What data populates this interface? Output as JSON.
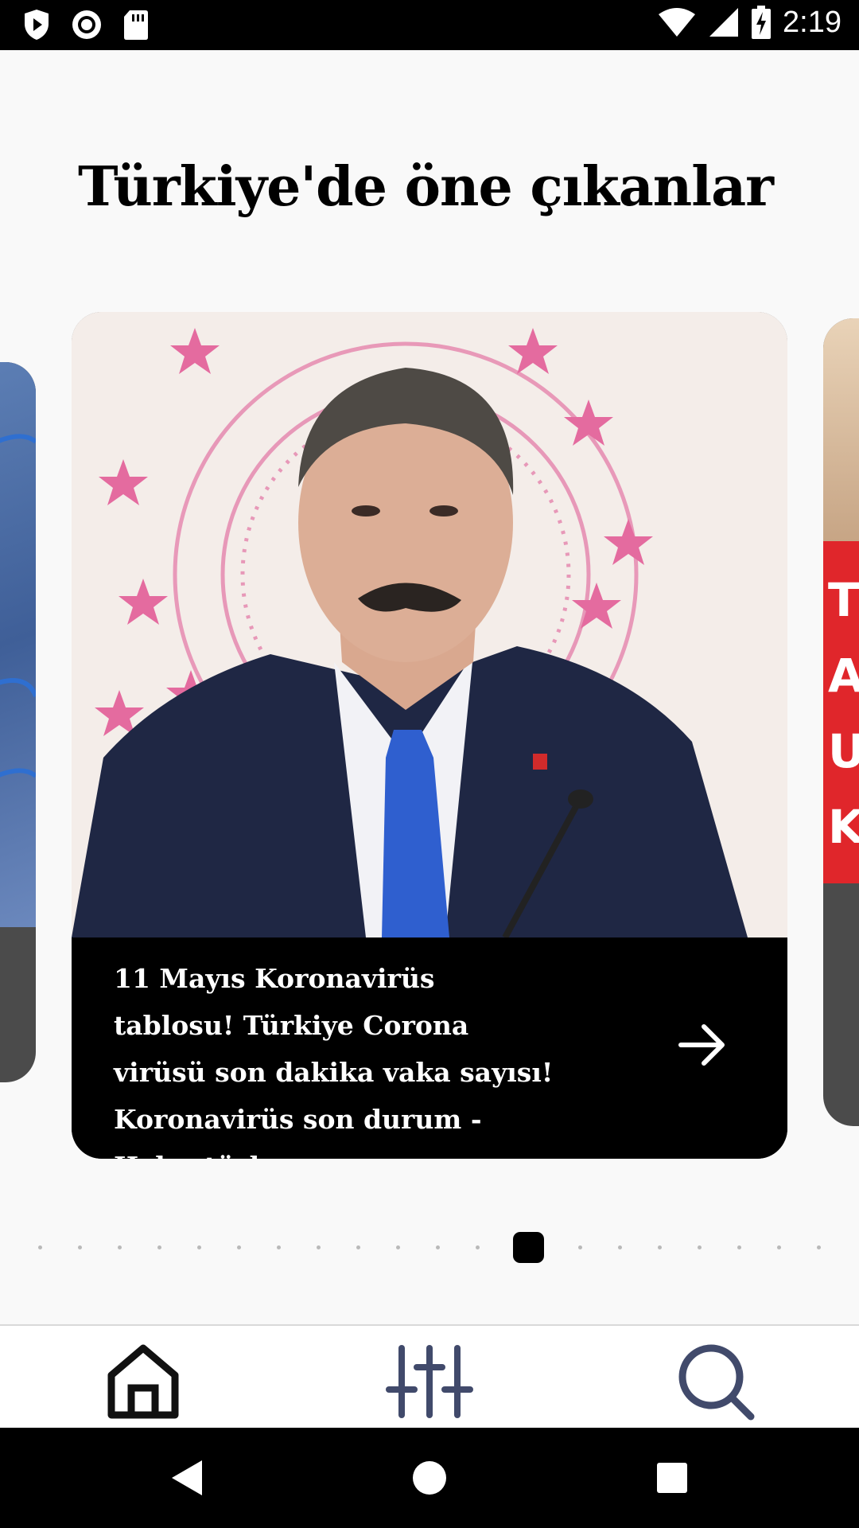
{
  "status_bar": {
    "time": "2:19",
    "left_icons": [
      "shield-play-icon",
      "record-icon",
      "sd-card-icon"
    ],
    "right_icons": [
      "wifi-icon",
      "signal-icon",
      "battery-charging-icon"
    ]
  },
  "section": {
    "title": "Türkiye'de öne çıkanlar"
  },
  "carousel": {
    "current_index": 12,
    "total": 20,
    "card": {
      "title": "11 Mayıs Koronavirüs tablosu! Türkiye Corona virüsü son dakika vaka sayısı! Koronavirüs son durum - Habertürk",
      "arrow_icon": "arrow-right-icon"
    }
  },
  "bottom_nav": {
    "items": [
      {
        "icon": "home-icon",
        "color": "#111111"
      },
      {
        "icon": "sliders-icon",
        "color": "#414a6b"
      },
      {
        "icon": "search-icon",
        "color": "#414a6b"
      }
    ]
  },
  "android_nav": [
    "back-icon",
    "home-circle-icon",
    "recents-icon"
  ]
}
